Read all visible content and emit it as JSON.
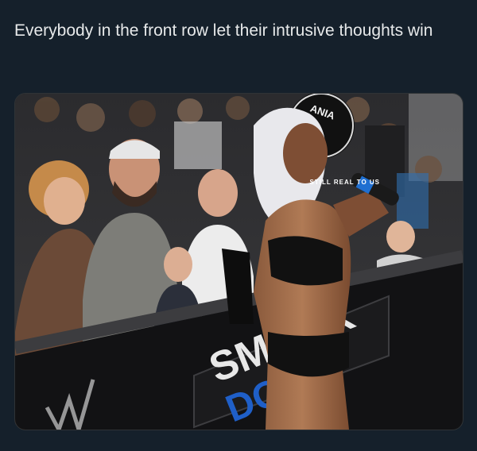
{
  "post": {
    "caption": "Everybody in the front row let their intrusive thoughts win",
    "watermark": "STILL REAL TO US"
  },
  "media": {
    "banner_text_top": "SMACK",
    "banner_text_bottom": "DOWN",
    "crowd_sign_text": "ANIA"
  },
  "colors": {
    "background": "#15202b",
    "caption_text": "#e7e9ea",
    "banner_blue": "#1f5fc8"
  }
}
